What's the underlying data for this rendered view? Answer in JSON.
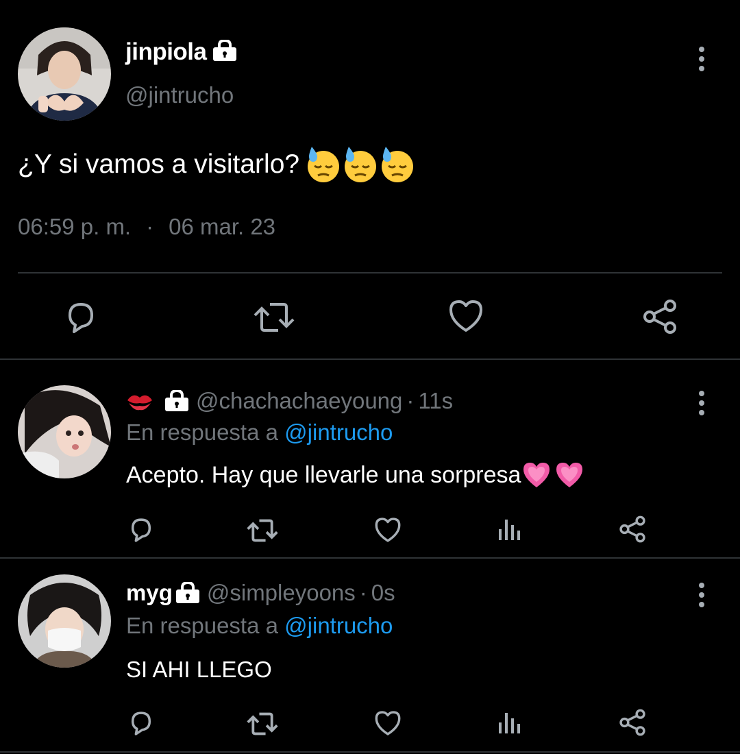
{
  "main_tweet": {
    "display_name": "jinpiola",
    "handle": "@jintrucho",
    "text": "¿Y si vamos a visitarlo?",
    "time": "06:59 p. m.",
    "separator": "·",
    "date": "06 mar. 23",
    "icons": [
      "lock-icon",
      "downcast-sweat-emoji",
      "reply-icon",
      "retweet-icon",
      "like-icon",
      "share-icon",
      "more-icon"
    ]
  },
  "replies": [
    {
      "display_name": "",
      "handle": "@chachachaeyoung",
      "separator": "·",
      "time": "11s",
      "reply_prefix": "En respuesta a",
      "reply_to": "@jintrucho",
      "text": "Acepto. Hay que llevarle una sorpresa",
      "icons": [
        "kiss-mark-emoji",
        "lock-icon",
        "growing-heart-emoji"
      ]
    },
    {
      "display_name": "myg",
      "handle": "@simpleyoons",
      "separator": "·",
      "time": "0s",
      "reply_prefix": "En respuesta a",
      "reply_to": "@jintrucho",
      "text": "SI AHI LLEGO",
      "icons": [
        "lock-icon"
      ]
    }
  ],
  "colors": {
    "background": "#000000",
    "text": "#e7e9ea",
    "muted": "#71767b",
    "link": "#1d9bf0",
    "divider": "#2f3336"
  }
}
